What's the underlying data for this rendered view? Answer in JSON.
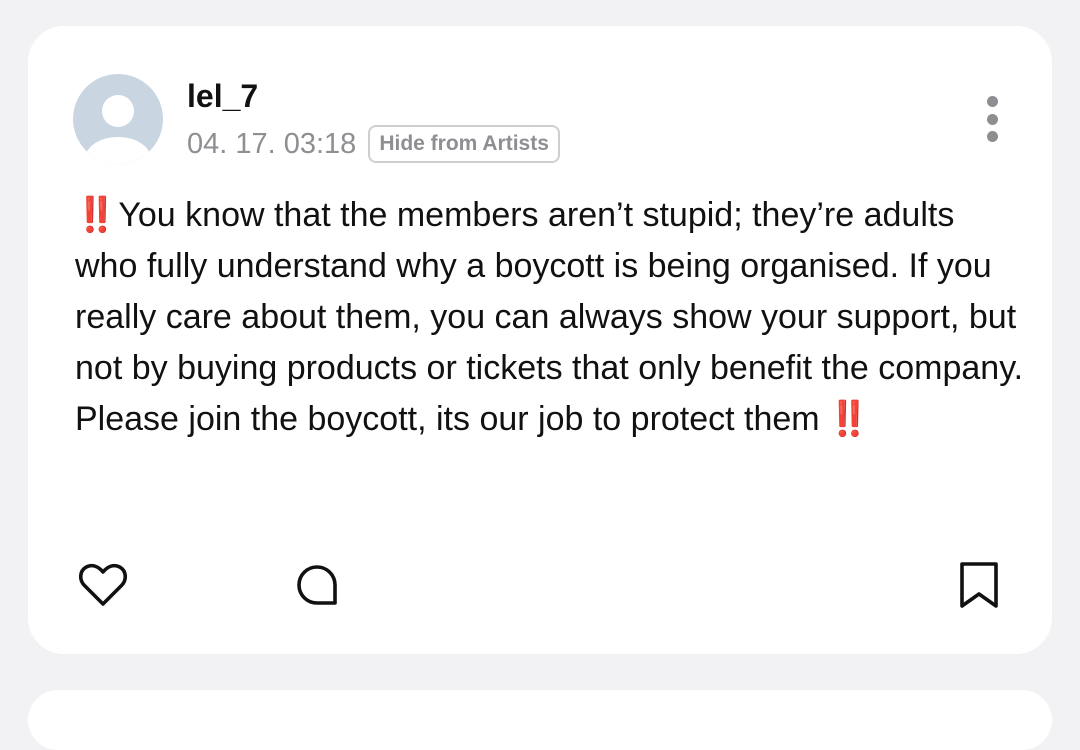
{
  "post": {
    "username": "lel_7",
    "timestamp": "04. 17. 03:18",
    "hide_badge": "Hide from Artists",
    "emoji_lead": "‼️",
    "body": "You know that the members aren’t stupid; they’re adults who fully understand why a boycott is being organised. If you really care about them, you can always show your support, but not by buying products or tickets that only benefit the company. Please join the boycott, its our job to protect them",
    "emoji_tail": "‼️"
  },
  "icons": {
    "avatar": "default-user-avatar",
    "more": "more-vertical-icon",
    "like": "heart-outline-icon",
    "comment": "comment-bubble-icon",
    "bookmark": "bookmark-outline-icon"
  },
  "colors": {
    "background": "#f2f2f4",
    "card": "#ffffff",
    "text": "#111111",
    "muted": "#8e8e93",
    "avatar_bg": "#c9d6e2",
    "emoji_red": "#e0314b"
  }
}
